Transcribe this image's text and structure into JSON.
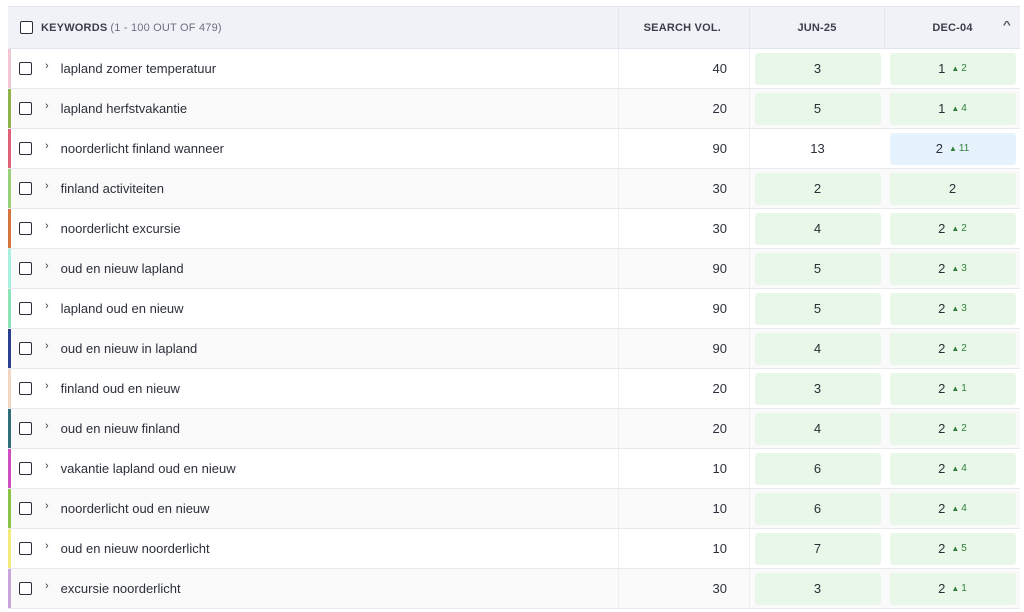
{
  "header": {
    "keywords_label": "KEYWORDS",
    "keywords_count": "(1 - 100 OUT OF 479)",
    "search_vol_label": "SEARCH VOL.",
    "date1_label": "JUN-25",
    "date2_label": "DEC-04"
  },
  "colors": {
    "green_cell": "#e8f7e7",
    "blue_cell": "#e6f3fd",
    "change_up": "#2f7f3a"
  },
  "rows": [
    {
      "keyword": "lapland zomer temperatuur",
      "vol": "40",
      "d1": "3",
      "d1_style": "green",
      "d2": "1",
      "d2_change": "2",
      "d2_style": "green",
      "bar": "#f3c6d3"
    },
    {
      "keyword": "lapland herfstvakantie",
      "vol": "20",
      "d1": "5",
      "d1_style": "green",
      "d2": "1",
      "d2_change": "4",
      "d2_style": "green",
      "bar": "#8fb34a"
    },
    {
      "keyword": "noorderlicht finland wanneer",
      "vol": "90",
      "d1": "13",
      "d1_style": "none",
      "d2": "2",
      "d2_change": "11",
      "d2_style": "blue",
      "bar": "#e0607a"
    },
    {
      "keyword": "finland activiteiten",
      "vol": "30",
      "d1": "2",
      "d1_style": "green",
      "d2": "2",
      "d2_change": "",
      "d2_style": "green",
      "bar": "#9ad07a"
    },
    {
      "keyword": "noorderlicht excursie",
      "vol": "30",
      "d1": "4",
      "d1_style": "green",
      "d2": "2",
      "d2_change": "2",
      "d2_style": "green",
      "bar": "#d4743f"
    },
    {
      "keyword": "oud en nieuw lapland",
      "vol": "90",
      "d1": "5",
      "d1_style": "green",
      "d2": "2",
      "d2_change": "3",
      "d2_style": "green",
      "bar": "#a8efe0"
    },
    {
      "keyword": "lapland oud en nieuw",
      "vol": "90",
      "d1": "5",
      "d1_style": "green",
      "d2": "2",
      "d2_change": "3",
      "d2_style": "green",
      "bar": "#8fe3b8"
    },
    {
      "keyword": "oud en nieuw in lapland",
      "vol": "90",
      "d1": "4",
      "d1_style": "green",
      "d2": "2",
      "d2_change": "2",
      "d2_style": "green",
      "bar": "#2b3f8f"
    },
    {
      "keyword": "finland oud en nieuw",
      "vol": "20",
      "d1": "3",
      "d1_style": "green",
      "d2": "2",
      "d2_change": "1",
      "d2_style": "green",
      "bar": "#f1d6c4"
    },
    {
      "keyword": "oud en nieuw finland",
      "vol": "20",
      "d1": "4",
      "d1_style": "green",
      "d2": "2",
      "d2_change": "2",
      "d2_style": "green",
      "bar": "#2f6f7a"
    },
    {
      "keyword": "vakantie lapland oud en nieuw",
      "vol": "10",
      "d1": "6",
      "d1_style": "green",
      "d2": "2",
      "d2_change": "4",
      "d2_style": "green",
      "bar": "#d04fc0"
    },
    {
      "keyword": "noorderlicht oud en nieuw",
      "vol": "10",
      "d1": "6",
      "d1_style": "green",
      "d2": "2",
      "d2_change": "4",
      "d2_style": "green",
      "bar": "#8cc44a"
    },
    {
      "keyword": "oud en nieuw noorderlicht",
      "vol": "10",
      "d1": "7",
      "d1_style": "green",
      "d2": "2",
      "d2_change": "5",
      "d2_style": "green",
      "bar": "#f2ea7a"
    },
    {
      "keyword": "excursie noorderlicht",
      "vol": "30",
      "d1": "3",
      "d1_style": "green",
      "d2": "2",
      "d2_change": "1",
      "d2_style": "green",
      "bar": "#c9a6d9"
    }
  ]
}
